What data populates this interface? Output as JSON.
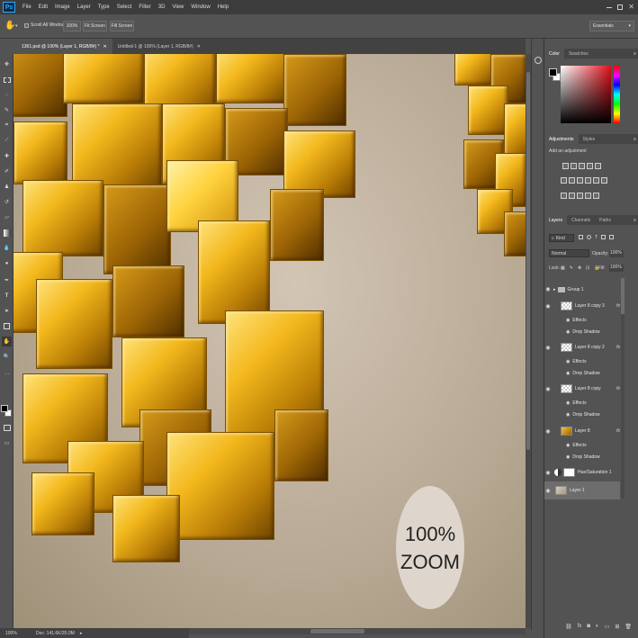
{
  "menubar": {
    "logo": "Ps",
    "items": [
      "File",
      "Edit",
      "Image",
      "Layer",
      "Type",
      "Select",
      "Filter",
      "3D",
      "View",
      "Window",
      "Help"
    ]
  },
  "options": {
    "scroll_all": "Scroll All Windows",
    "zoom_btn": "100%",
    "fit_screen": "Fit Screen",
    "fill_screen": "Fill Screen",
    "workspace": "Essentials"
  },
  "tabs": [
    {
      "label": "1361.psd @ 100% (Layer 1, RGB/8#) *",
      "active": true
    },
    {
      "label": "Untitled-1 @ 100% (Layer 1, RGB/8#)",
      "active": false
    }
  ],
  "canvas": {
    "zoom_line1": "100%",
    "zoom_line2": "ZOOM"
  },
  "status": {
    "zoom": "100%",
    "doc": "Doc: 141.6K/20.0M"
  },
  "color_panel": {
    "tabs": [
      "Color",
      "Swatches"
    ]
  },
  "adjustments_panel": {
    "tabs": [
      "Adjustments",
      "Styles"
    ],
    "hint": "Add an adjustment"
  },
  "layers_panel": {
    "tabs": [
      "Layers",
      "Channels",
      "Paths"
    ],
    "kind": "Kind",
    "blend_mode": "Normal",
    "opacity_label": "Opacity:",
    "opacity_value": "100%",
    "lock_label": "Lock:",
    "fill_label": "Fill:",
    "fill_value": "100%",
    "layers": [
      {
        "name": "Group 1",
        "type": "group"
      },
      {
        "name": "Layer 8 copy 3",
        "type": "layer",
        "fx": "fx"
      },
      {
        "name": "Effects",
        "type": "effects"
      },
      {
        "name": "Drop Shadow",
        "type": "effect"
      },
      {
        "name": "Layer 8 copy 2",
        "type": "layer",
        "fx": "fx"
      },
      {
        "name": "Effects",
        "type": "effects"
      },
      {
        "name": "Drop Shadow",
        "type": "effect"
      },
      {
        "name": "Layer 8 copy",
        "type": "layer",
        "fx": "fx"
      },
      {
        "name": "Effects",
        "type": "effects"
      },
      {
        "name": "Drop Shadow",
        "type": "effect"
      },
      {
        "name": "Layer 8",
        "type": "layer",
        "fx": "fx"
      },
      {
        "name": "Effects",
        "type": "effects"
      },
      {
        "name": "Drop Shadow",
        "type": "effect"
      },
      {
        "name": "Hue/Saturation 1",
        "type": "adjustment"
      },
      {
        "name": "Layer 1",
        "type": "layer",
        "selected": true
      }
    ]
  },
  "icons": {
    "hand_tool": "hand-icon",
    "tools": [
      "move-icon",
      "marquee-icon",
      "lasso-icon",
      "quick-select-icon",
      "crop-icon",
      "eyedropper-icon",
      "healing-icon",
      "brush-icon",
      "stamp-icon",
      "history-brush-icon",
      "eraser-icon",
      "gradient-icon",
      "blur-icon",
      "dodge-icon",
      "pen-icon",
      "type-icon",
      "path-select-icon",
      "shape-icon",
      "hand-icon",
      "zoom-icon"
    ]
  },
  "colors": {
    "foreground": "#000000",
    "background": "#ffffff",
    "accent": "#31a8ff"
  }
}
